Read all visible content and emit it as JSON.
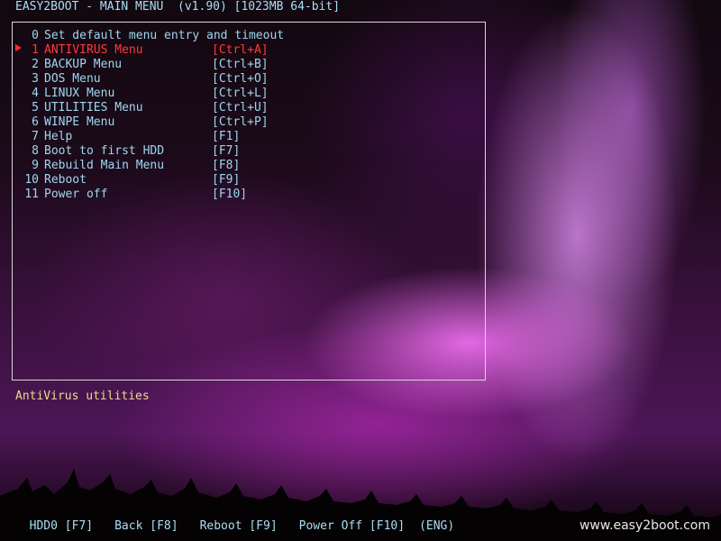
{
  "header": {
    "title": "EASY2BOOT - MAIN MENU  (v1.90) [1023MB 64-bit]"
  },
  "menu": {
    "selected_index": 1,
    "items": [
      {
        "num": "0",
        "label": "Set default menu entry and timeout",
        "hotkey": ""
      },
      {
        "num": "1",
        "label": "ANTIVIRUS Menu",
        "hotkey": "[Ctrl+A]"
      },
      {
        "num": "2",
        "label": "BACKUP Menu",
        "hotkey": "[Ctrl+B]"
      },
      {
        "num": "3",
        "label": "DOS Menu",
        "hotkey": "[Ctrl+O]"
      },
      {
        "num": "4",
        "label": "LINUX Menu",
        "hotkey": "[Ctrl+L]"
      },
      {
        "num": "5",
        "label": "UTILITIES Menu",
        "hotkey": "[Ctrl+U]"
      },
      {
        "num": "6",
        "label": "WINPE Menu",
        "hotkey": "[Ctrl+P]"
      },
      {
        "num": "7",
        "label": "Help",
        "hotkey": "[F1]"
      },
      {
        "num": "8",
        "label": "Boot to first HDD",
        "hotkey": "[F7]"
      },
      {
        "num": "9",
        "label": "Rebuild Main Menu",
        "hotkey": "[F8]"
      },
      {
        "num": "10",
        "label": "Reboot",
        "hotkey": "[F9]"
      },
      {
        "num": "11",
        "label": "Power off",
        "hotkey": "[F10]"
      }
    ]
  },
  "help": {
    "text": "AntiVirus utilities"
  },
  "footer": {
    "hdd": "HDD0 [F7]",
    "back": "Back [F8]",
    "reboot": "Reboot [F9]",
    "power_off": "Power Off [F10]",
    "lang": "(ENG)"
  },
  "watermark": "www.easy2boot.com",
  "colors": {
    "menu_text": "#9fd7f0",
    "selected": "#ff3a3a",
    "help_text": "#f2d890",
    "frame": "#d8d8d8"
  },
  "icons": {
    "selection_marker": "triangle-right-icon"
  }
}
